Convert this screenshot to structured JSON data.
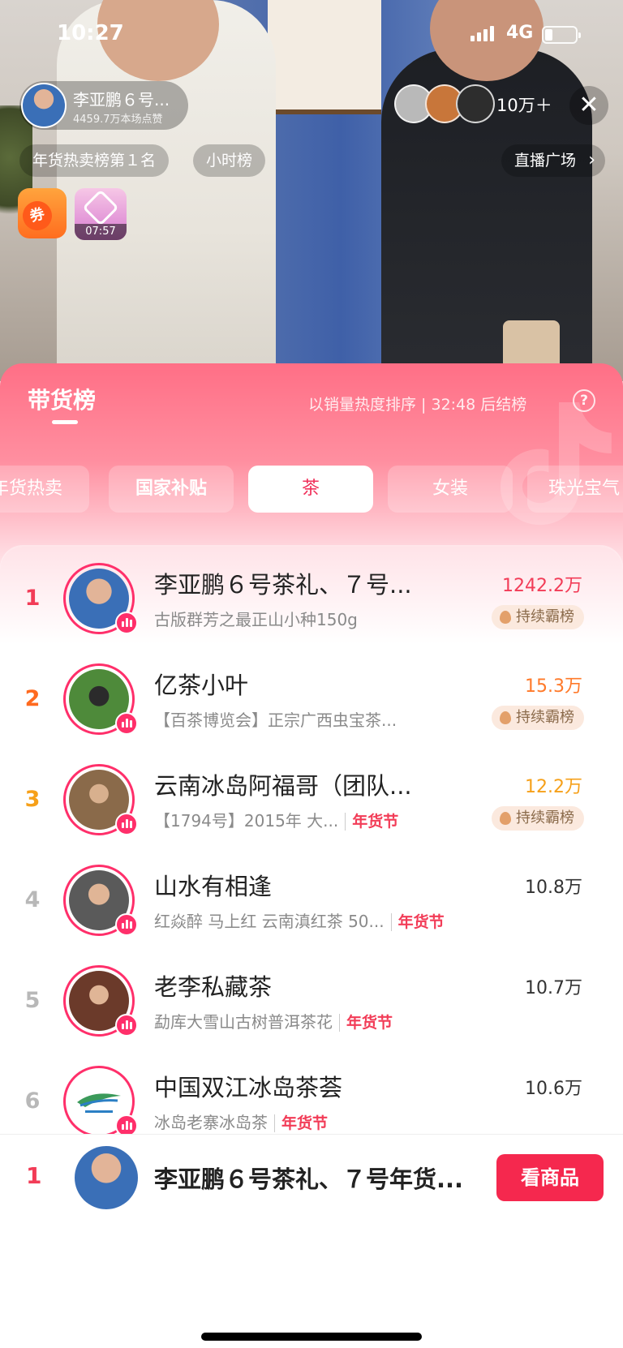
{
  "status_bar": {
    "time": "10:27",
    "network": "4G"
  },
  "host": {
    "name": "李亚鹏６号...",
    "likes": "4459.7万本场点赞"
  },
  "viewer_count": "10万＋",
  "chips": {
    "rank": "年货热卖榜第１名",
    "hourly": "小时榜",
    "plaza": "直播广场"
  },
  "coupon_label": "券",
  "gift_timer": "07:57",
  "panel": {
    "title": "带货榜",
    "description": "以销量热度排序 | 32:48 后结榜",
    "help": "?"
  },
  "tabs": [
    {
      "label": "年货热卖"
    },
    {
      "label": "国家补贴"
    },
    {
      "label": "茶"
    },
    {
      "label": "女装"
    },
    {
      "label": "珠光宝气"
    }
  ],
  "rankings": [
    {
      "rank": "1",
      "title": "李亚鹏６号茶礼、７号...",
      "subtitle": "古版群芳之最正山小种150g",
      "tag": "",
      "value": "1242.2万",
      "badge": "持续霸榜"
    },
    {
      "rank": "2",
      "title": "亿茶小叶",
      "subtitle": "【百茶博览会】正宗广西虫宝茶...",
      "tag": "",
      "value": "15.3万",
      "badge": "持续霸榜"
    },
    {
      "rank": "3",
      "title": "云南冰岛阿福哥（团队...",
      "subtitle": "【1794号】2015年 大...",
      "tag": "年货节",
      "value": "12.2万",
      "badge": "持续霸榜"
    },
    {
      "rank": "4",
      "title": "山水有相逢",
      "subtitle": "红焱醉 马上红 云南滇红茶 50...",
      "tag": "年货节",
      "value": "10.8万",
      "badge": ""
    },
    {
      "rank": "5",
      "title": "老李私藏茶",
      "subtitle": "勐库大雪山古树普洱茶花",
      "tag": "年货节",
      "value": "10.7万",
      "badge": ""
    },
    {
      "rank": "6",
      "title": "中国双江冰岛茶荟",
      "subtitle": "冰岛老寨冰岛茶",
      "tag": "年货节",
      "value": "10.6万",
      "badge": ""
    }
  ],
  "bottom_bar": {
    "rank": "1",
    "title": "李亚鹏６号茶礼、７号年货...",
    "button": "看商品"
  },
  "colors": {
    "accent": "#f23c57",
    "panel_pink": "#ff6f86",
    "button": "#f5284e"
  }
}
